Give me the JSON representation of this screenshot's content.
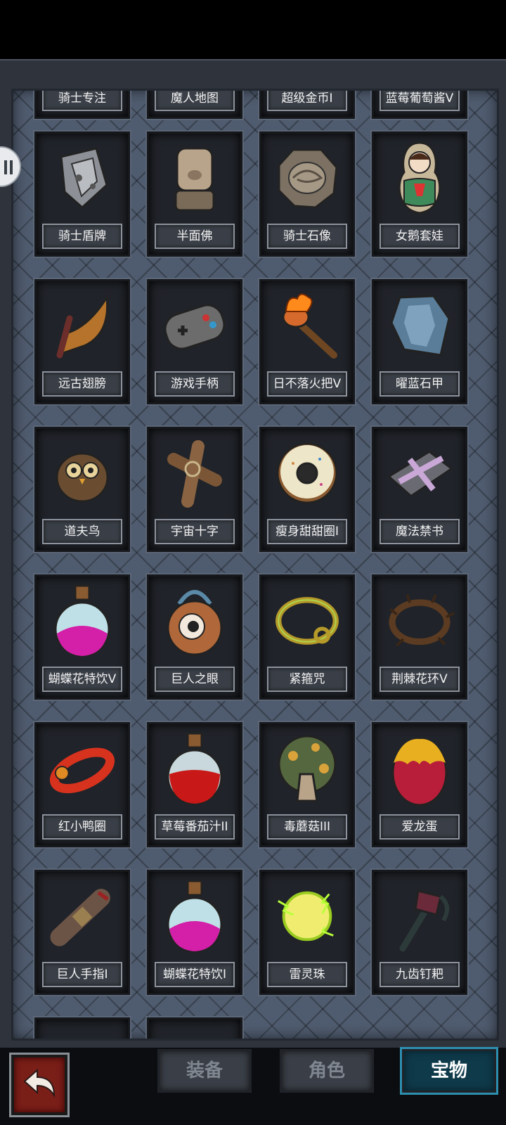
{
  "top_partial_items": [
    "骑士专注",
    "魔人地图",
    "超级金币I",
    "蓝莓葡萄酱V"
  ],
  "items": [
    {
      "name": "骑士盾牌",
      "icon": "knight-shield-icon"
    },
    {
      "name": "半面佛",
      "icon": "half-buddha-statue-icon"
    },
    {
      "name": "骑士石像",
      "icon": "stone-plate-icon"
    },
    {
      "name": "女鹅套娃",
      "icon": "matryoshka-doll-icon"
    },
    {
      "name": "远古翅膀",
      "icon": "ancient-wing-icon"
    },
    {
      "name": "游戏手柄",
      "icon": "gamepad-icon"
    },
    {
      "name": "日不落火把V",
      "icon": "torch-icon"
    },
    {
      "name": "曜蓝石甲",
      "icon": "blue-armor-icon"
    },
    {
      "name": "道夫鸟",
      "icon": "owl-icon"
    },
    {
      "name": "宇宙十字",
      "icon": "wooden-cross-icon"
    },
    {
      "name": "瘦身甜甜圈I",
      "icon": "donut-icon"
    },
    {
      "name": "魔法禁书",
      "icon": "forbidden-book-icon"
    },
    {
      "name": "蝴蝶花特饮V",
      "icon": "pink-potion-icon"
    },
    {
      "name": "巨人之眼",
      "icon": "giant-eye-icon"
    },
    {
      "name": "紧箍咒",
      "icon": "golden-circlet-icon"
    },
    {
      "name": "荆棘花环V",
      "icon": "thorn-wreath-icon"
    },
    {
      "name": "红小鸭圈",
      "icon": "red-duck-ring-icon"
    },
    {
      "name": "草莓番茄汁II",
      "icon": "red-potion-icon"
    },
    {
      "name": "毒蘑菇III",
      "icon": "poison-mushroom-icon"
    },
    {
      "name": "爱龙蛋",
      "icon": "dragon-egg-icon"
    },
    {
      "name": "巨人手指I",
      "icon": "giant-finger-icon"
    },
    {
      "name": "蝴蝶花特饮I",
      "icon": "pink-potion-icon"
    },
    {
      "name": "雷灵珠",
      "icon": "thunder-orb-icon"
    },
    {
      "name": "九齿钉耙",
      "icon": "nine-tooth-rake-icon"
    }
  ],
  "tabs": {
    "equipment": "装备",
    "character": "角色",
    "treasure": "宝物"
  },
  "active_tab": "treasure"
}
